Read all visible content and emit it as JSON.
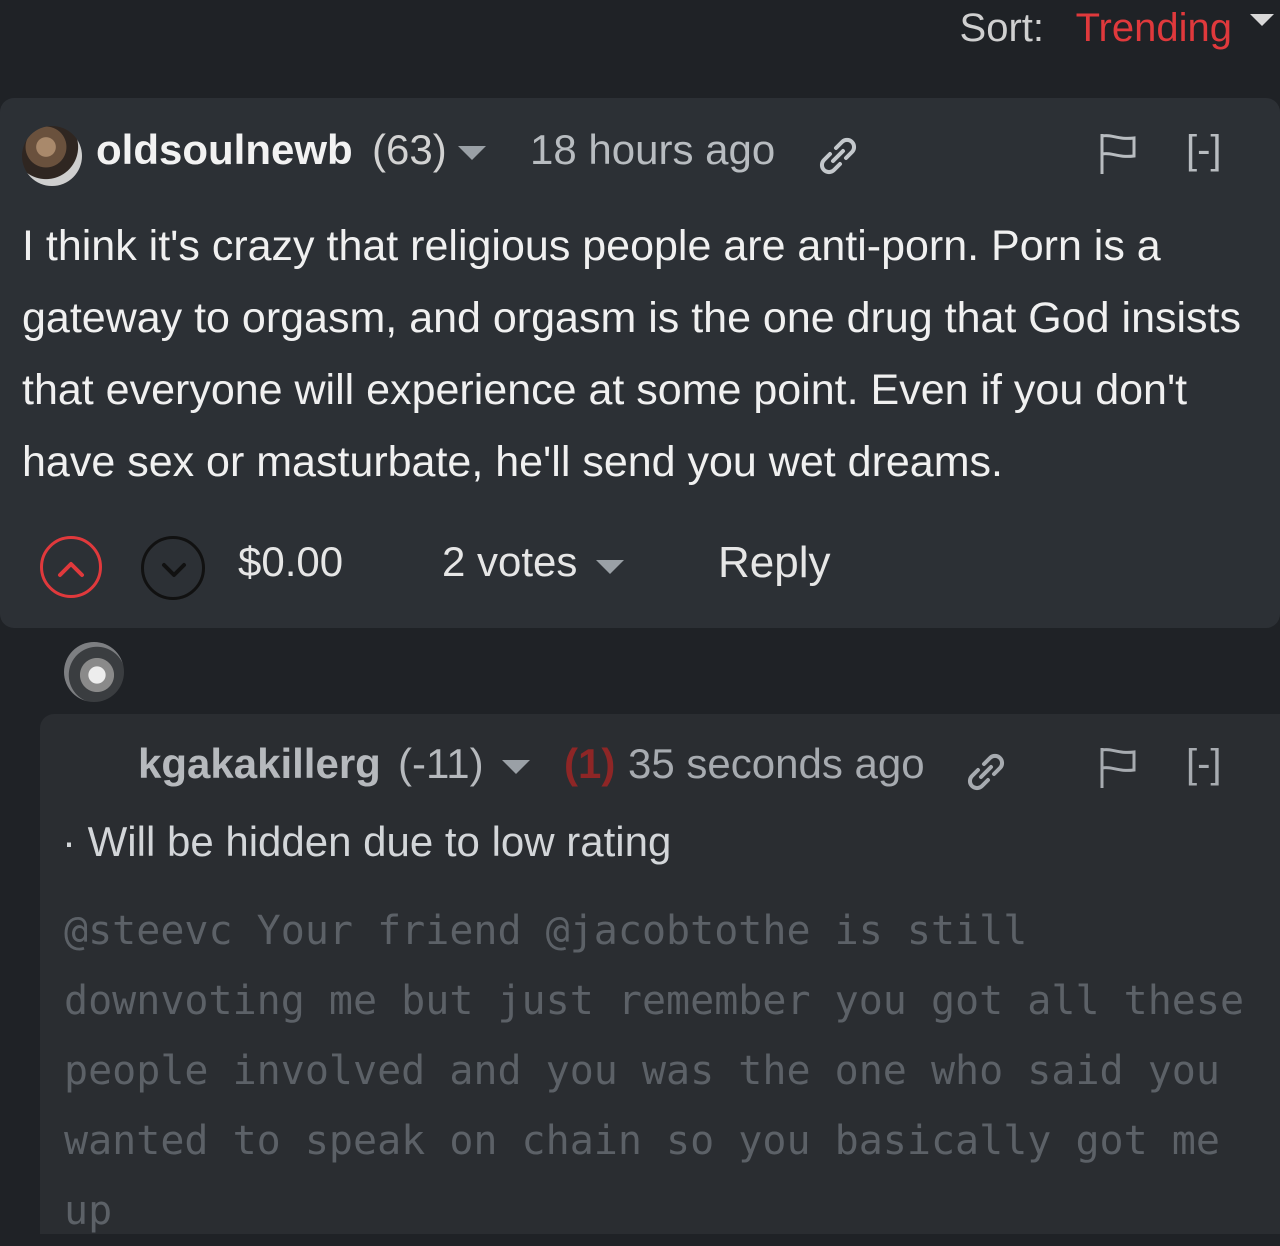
{
  "sort": {
    "label": "Sort:",
    "value": "Trending"
  },
  "comment": {
    "author": "oldsoulnewb",
    "reputation": "(63)",
    "time": "18 hours ago",
    "collapse": "[-]",
    "body": "I think it's crazy that religious people are anti-porn. Porn is a gateway to orgasm, and orgasm is the one drug that God insists that everyone will experience at some point. Even if you don't have sex or masturbate, he'll send you wet dreams.",
    "payout": "$0.00",
    "votes": "2 votes",
    "reply": "Reply"
  },
  "reply_comment": {
    "author": "kgakakillerg",
    "reputation": "(-11)",
    "badge": "(1)",
    "time": "35 seconds ago",
    "collapse": "[-]",
    "hidden_note": "· Will be hidden due to low rating",
    "body": "@steevc Your friend @jacobtothe is still downvoting me but just remember you got all these people involved and you was the one who said you wanted to speak on chain so you basically got me up"
  },
  "colors": {
    "accent": "#e0393c",
    "background": "#1f2226",
    "card": "#2c3035"
  },
  "icons": [
    "link-icon",
    "flag-icon",
    "chevron-up-icon",
    "chevron-down-icon",
    "dropdown-caret-icon"
  ]
}
